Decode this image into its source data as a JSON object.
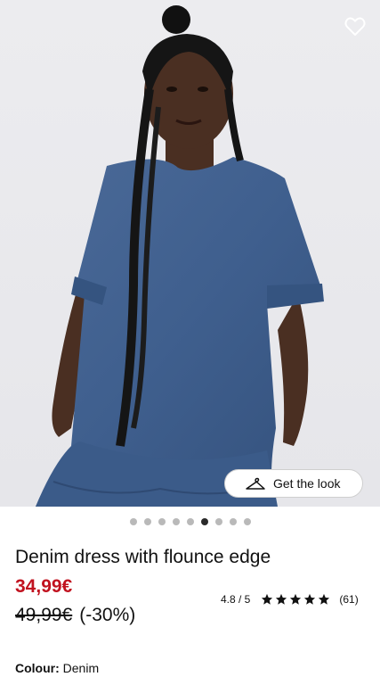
{
  "hero": {
    "image_alt": "Model wearing denim dress",
    "favorite_icon": "heart-outline-icon",
    "get_the_look": {
      "icon": "hanger-icon",
      "label": "Get the look"
    },
    "carousel": {
      "count": 9,
      "active_index": 5
    }
  },
  "product": {
    "title": "Denim dress with flounce edge",
    "price_now": "34,99€",
    "price_old": "49,99€",
    "discount": "(-30%)",
    "rating": {
      "score_text": "4.8 / 5",
      "stars": 5,
      "count_text": "(61)"
    },
    "colour": {
      "label": "Colour:",
      "value": "Denim"
    }
  },
  "colors": {
    "sale_red": "#c1121f",
    "denim": "#3e5f8f"
  }
}
